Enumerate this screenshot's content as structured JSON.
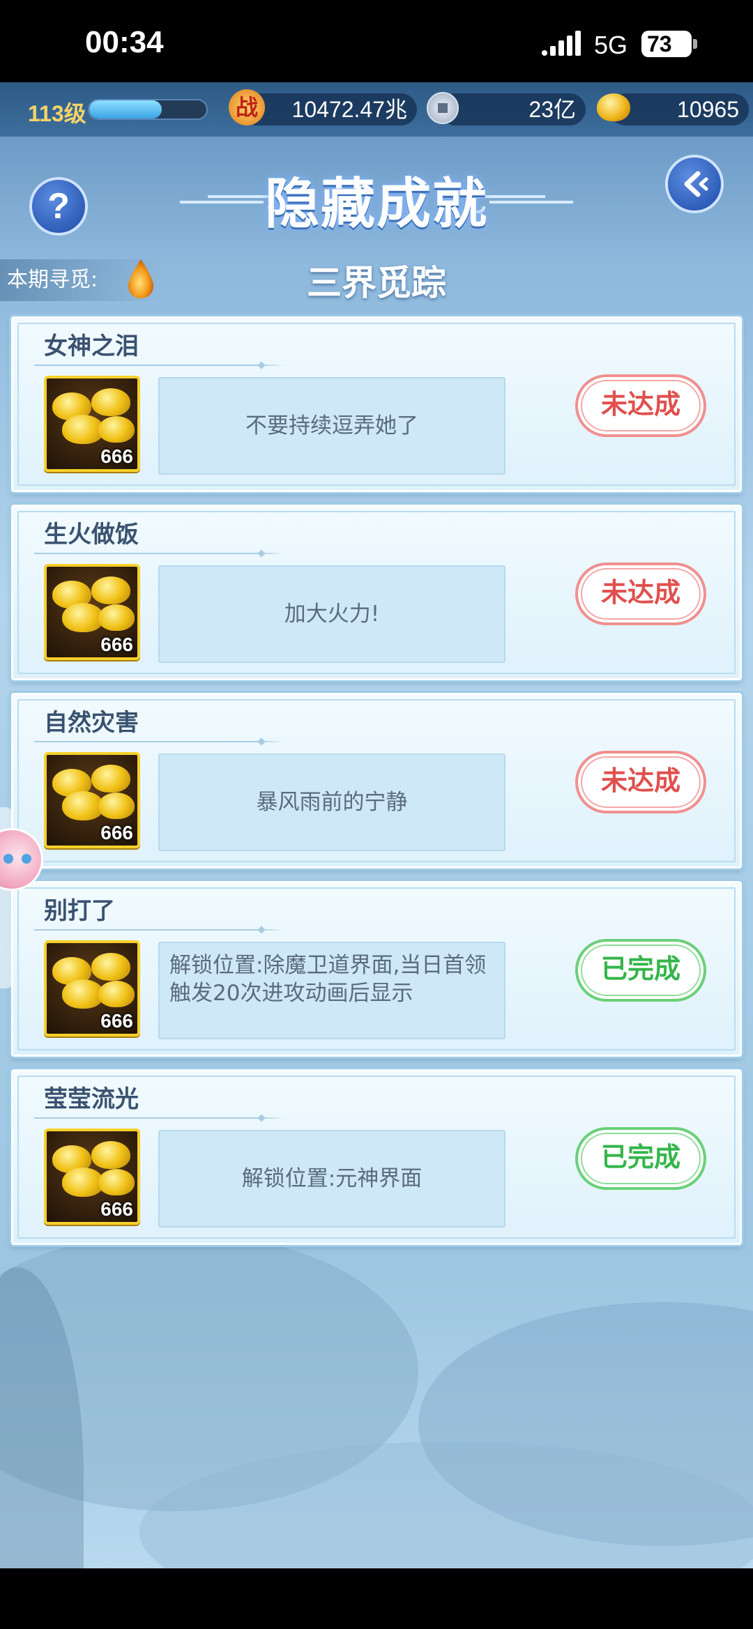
{
  "status_bar": {
    "time": "00:34",
    "network": "5G",
    "battery": "73"
  },
  "top_bar": {
    "level": "113级",
    "xp_fraction": 0.62,
    "power_icon_char": "战",
    "power": "10472.47兆",
    "coins": "23亿",
    "gold_ingots": "10965"
  },
  "header": {
    "title": "隐藏成就",
    "help_icon": "?",
    "back_icon": "back-arrow-icon",
    "seek_label": "本期寻觅:",
    "subtitle": "三界觅踪"
  },
  "achievements": [
    {
      "name": "女神之泪",
      "reward_count": "666",
      "description": "不要持续逗弄她了",
      "status": "未达成",
      "state": "pending"
    },
    {
      "name": "生火做饭",
      "reward_count": "666",
      "description": "加大火力!",
      "status": "未达成",
      "state": "pending"
    },
    {
      "name": "自然灾害",
      "reward_count": "666",
      "description": "暴风雨前的宁静",
      "status": "未达成",
      "state": "pending"
    },
    {
      "name": "别打了",
      "reward_count": "666",
      "description": "解锁位置:除魔卫道界面,当日首领触发20次进攻动画后显示",
      "status": "已完成",
      "state": "done"
    },
    {
      "name": "莹莹流光",
      "reward_count": "666",
      "description": "解锁位置:元神界面",
      "status": "已完成",
      "state": "done"
    }
  ],
  "colors": {
    "pending": "#e0504e",
    "done": "#35b54a",
    "title_glow": "#3c70b8"
  }
}
